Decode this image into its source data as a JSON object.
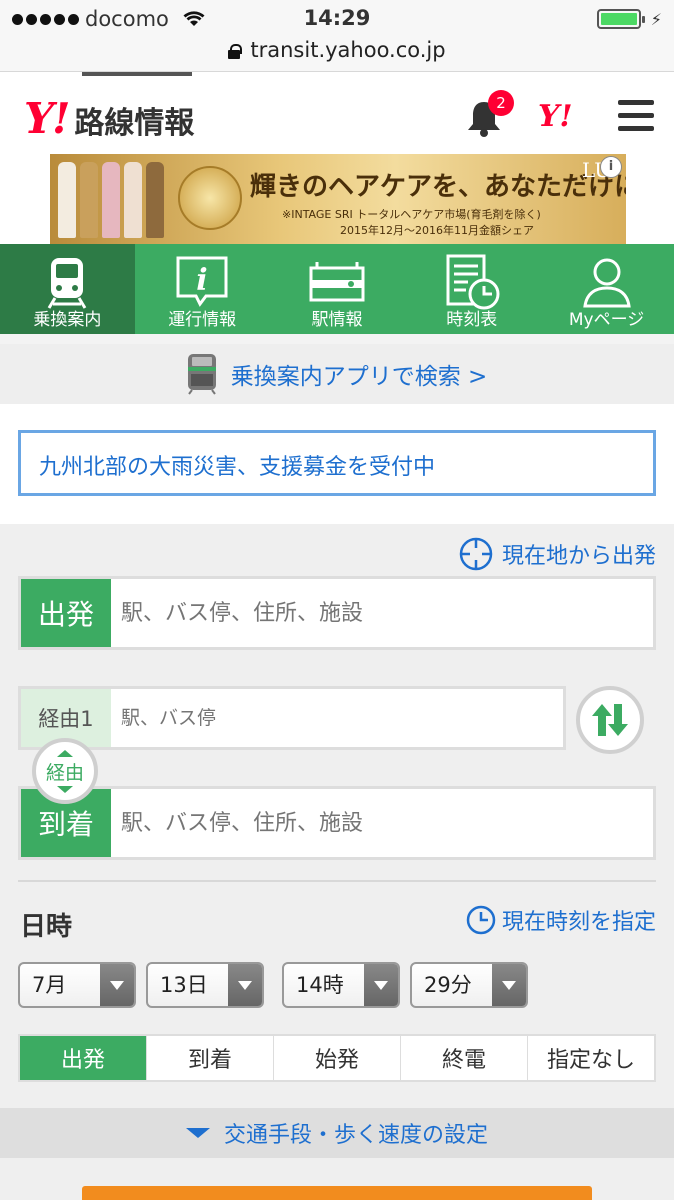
{
  "status_bar": {
    "carrier": "docomo",
    "time": "14:29",
    "url": "transit.yahoo.co.jp"
  },
  "header": {
    "logo_mark": "Y!",
    "logo_text": "路線情報",
    "notification_count": "2",
    "yahoo_mark": "Y!"
  },
  "ad": {
    "headline": "輝きのヘアケアを、あなただけに。",
    "note1": "※INTAGE SRI トータルヘアケア市場(育毛剤を除く)",
    "note2": "2015年12月〜2016年11月金額シェア",
    "brand": "LU",
    "info_label": "i"
  },
  "nav": {
    "tabs": [
      {
        "label": "乗換案内",
        "active": true
      },
      {
        "label": "運行情報",
        "active": false
      },
      {
        "label": "駅情報",
        "active": false
      },
      {
        "label": "時刻表",
        "active": false
      },
      {
        "label": "Myページ",
        "active": false
      }
    ]
  },
  "app_link": "乗換案内アプリで検索 >",
  "notice": "九州北部の大雨災害、支援募金を受付中",
  "search": {
    "current_location": "現在地から出発",
    "departure_label": "出発",
    "departure_placeholder": "駅、バス停、住所、施設",
    "via_label": "経由1",
    "via_placeholder": "駅、バス停",
    "via_toggle": "経由",
    "arrival_label": "到着",
    "arrival_placeholder": "駅、バス停、住所、施設"
  },
  "datetime": {
    "title": "日時",
    "now_label": "現在時刻を指定",
    "month": "7月",
    "day": "13日",
    "hour": "14時",
    "minute": "29分",
    "modes": [
      "出発",
      "到着",
      "始発",
      "終電",
      "指定なし"
    ],
    "active_mode": "出発"
  },
  "settings_link": "交通手段・歩く速度の設定",
  "colors": {
    "green": "#3cab62",
    "dark_green": "#2d7b46",
    "link_blue": "#1e6fcf",
    "yahoo_red": "#ff0033",
    "search_orange": "#f28c1e"
  }
}
